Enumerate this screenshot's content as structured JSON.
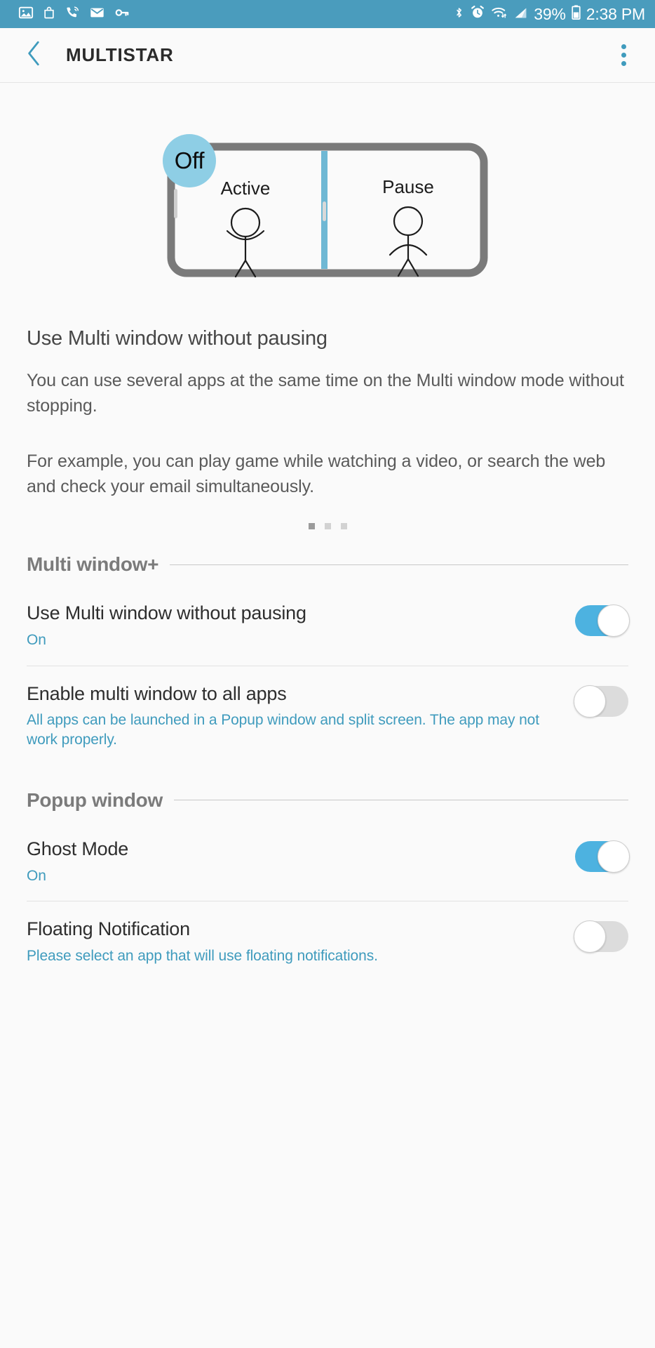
{
  "status_bar": {
    "background": "#4a9cbd",
    "left_icons": [
      "image-icon",
      "shopping-bag-icon",
      "wifi-calling-icon",
      "mail-icon",
      "key-icon"
    ],
    "right_icons": [
      "bluetooth-icon",
      "alarm-icon",
      "wifi-icon",
      "signal-icon",
      "battery-icon"
    ],
    "battery_percent": "39%",
    "time": "2:38 PM"
  },
  "action_bar": {
    "back_icon": "chevron-left-icon",
    "title": "MULTISTAR",
    "overflow_icon": "more-vert-icon",
    "accent": "#3f9bbd"
  },
  "hero": {
    "badge_label": "Off",
    "badge_color": "#8ecee5",
    "left_pane_label": "Active",
    "right_pane_label": "Pause",
    "frame_color": "#7a7a7a",
    "divider_color": "#6fb8d4"
  },
  "intro": {
    "title": "Use Multi window without pausing",
    "paragraph_1": "You can use several apps at the same time on the Multi window mode without stopping.",
    "paragraph_2": "For example, you can play game while watching a video, or search the web and check your email simultaneously.",
    "page_dots": 3,
    "active_dot_index": 0
  },
  "sections": [
    {
      "label": "Multi window+",
      "rows": [
        {
          "title": "Use Multi window without pausing",
          "subtitle": "On",
          "toggle_state": "on"
        },
        {
          "title": "Enable multi window to all apps",
          "subtitle": "All apps can be launched in a Popup window and split screen. The app may not work properly.",
          "toggle_state": "off"
        }
      ]
    },
    {
      "label": "Popup window",
      "rows": [
        {
          "title": "Ghost Mode",
          "subtitle": "On",
          "toggle_state": "on"
        },
        {
          "title": "Floating Notification",
          "subtitle": "Please select an app that will use floating notifications.",
          "toggle_state": "off"
        }
      ]
    }
  ],
  "colors": {
    "accent": "#4db2e0",
    "subtitle_link": "#3f9bbd",
    "page_background": "#fafafa",
    "status_bar": "#4a9cbd"
  }
}
